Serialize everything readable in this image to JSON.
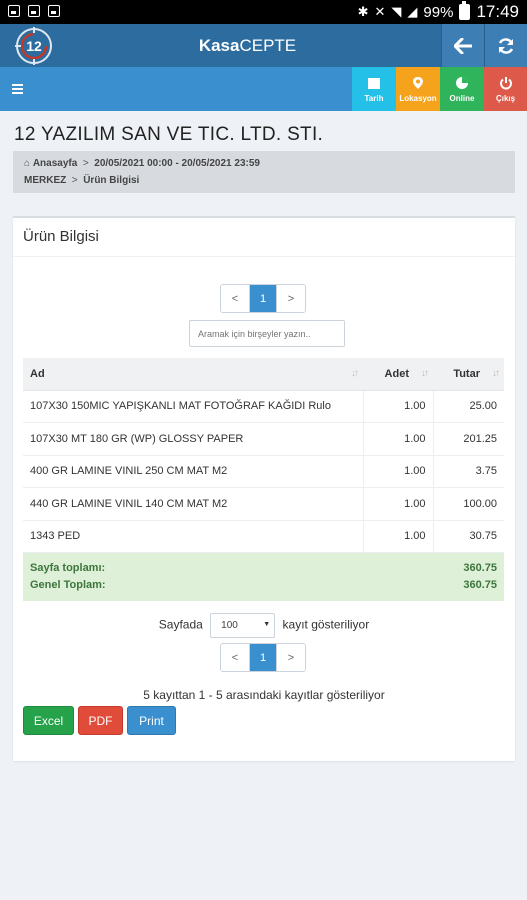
{
  "status_bar": {
    "battery": "99%",
    "time": "17:49"
  },
  "header": {
    "brand_bold": "Kasa",
    "brand_light": "CEPTE",
    "logo_text": "12"
  },
  "toolbar": {
    "tarih": "Tarih",
    "lokasyon": "Lokasyon",
    "online": "Online",
    "cikis": "Çıkış",
    "colors": {
      "tarih": "#25c0e8",
      "lokasyon": "#f5a31c",
      "online": "#2fb45c",
      "cikis": "#dd5a4b"
    }
  },
  "company": "12 YAZILIM SAN VE TIC. LTD. STI.",
  "breadcrumb": {
    "home": "Anasayfa",
    "sep": ">",
    "date_range": "20/05/2021 00:00 - 20/05/2021 23:59",
    "branch": "MERKEZ",
    "current": "Ürün Bilgisi"
  },
  "panel": {
    "title": "Ürün Bilgisi",
    "search_placeholder": "Aramak için birşeyler yazın..",
    "pager": {
      "prev": "<",
      "page": "1",
      "next": ">"
    },
    "table": {
      "headers": {
        "name": "Ad",
        "qty": "Adet",
        "total": "Tutar"
      },
      "rows": [
        {
          "name": "107X30 150MIC YAPIŞKANLI MAT FOTOĞRAF KAĞIDI Rulo",
          "qty": "1.00",
          "total": "25.00"
        },
        {
          "name": "107X30 MT 180 GR (WP) GLOSSY PAPER",
          "qty": "1.00",
          "total": "201.25"
        },
        {
          "name": "400 GR LAMINE VINIL 250 CM MAT M2",
          "qty": "1.00",
          "total": "3.75"
        },
        {
          "name": "440 GR LAMINE VINIL 140 CM MAT M2",
          "qty": "1.00",
          "total": "100.00"
        },
        {
          "name": "1343 PED",
          "qty": "1.00",
          "total": "30.75"
        }
      ],
      "page_total_label": "Sayfa toplamı:",
      "page_total": "360.75",
      "grand_total_label": "Genel Toplam:",
      "grand_total": "360.75"
    },
    "page_size_prefix": "Sayfada",
    "page_size_value": "100",
    "page_size_suffix": "kayıt gösteriliyor",
    "info": "5 kayıttan 1 - 5 arasındaki kayıtlar gösteriliyor",
    "buttons": {
      "excel": "Excel",
      "pdf": "PDF",
      "print": "Print"
    }
  }
}
